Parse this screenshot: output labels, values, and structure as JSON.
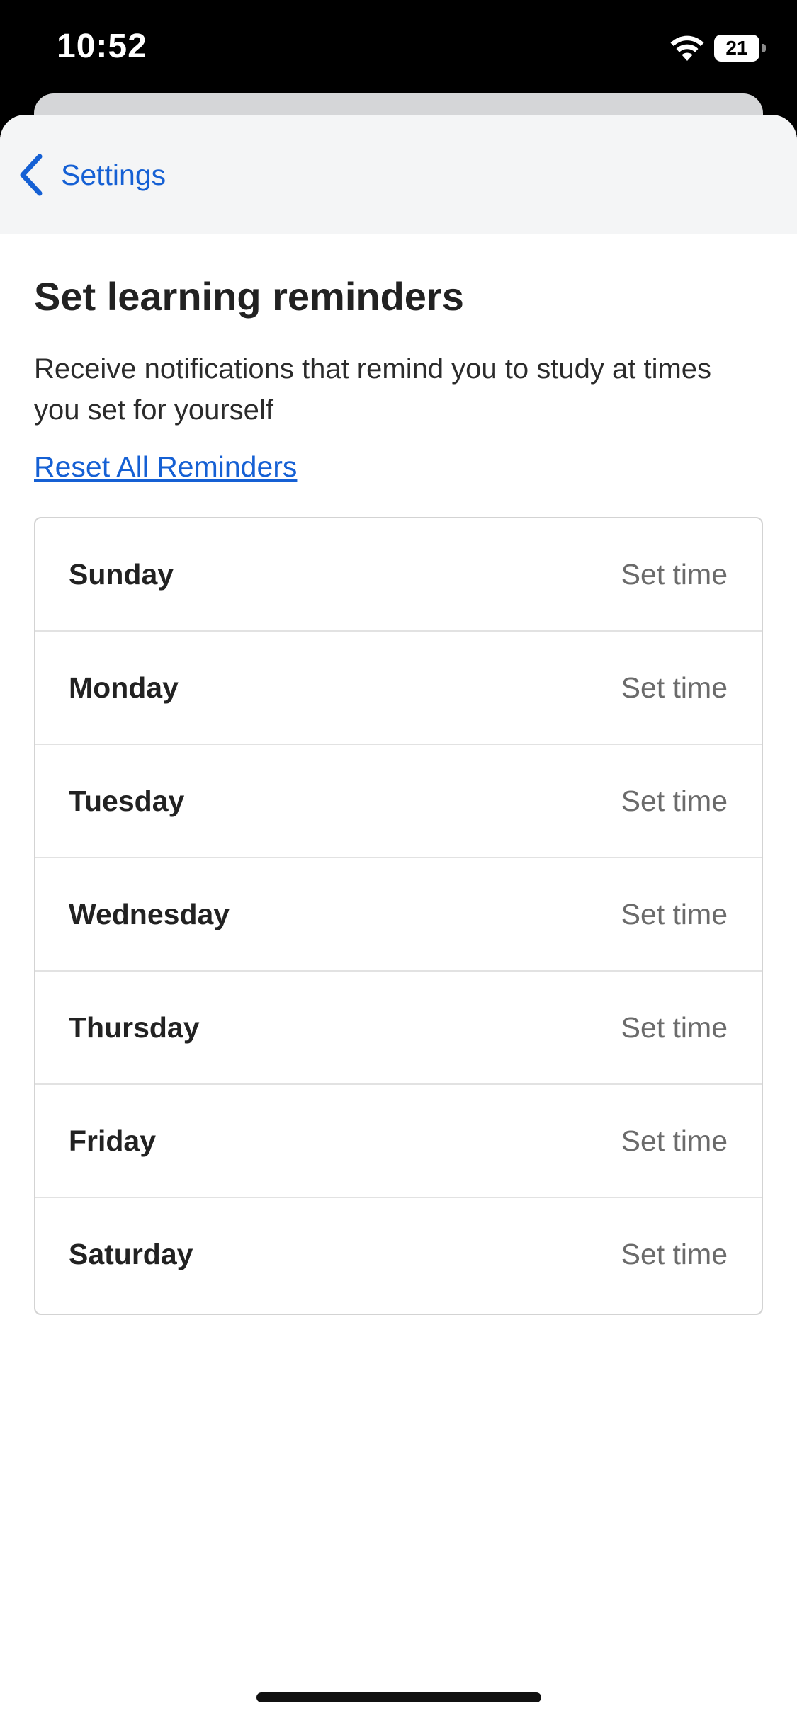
{
  "status_bar": {
    "time": "10:52",
    "battery_level": "21",
    "icons": [
      "wifi-icon",
      "battery-icon"
    ]
  },
  "nav": {
    "back_label": "Settings",
    "back_icon": "chevron-left-icon",
    "accent_color": "#1560d4"
  },
  "main": {
    "title": "Set learning reminders",
    "description": "Receive notifications that remind you to study at times you set for yourself",
    "reset_label": "Reset All Reminders"
  },
  "days": [
    {
      "name": "Sunday",
      "action": "Set time"
    },
    {
      "name": "Monday",
      "action": "Set time"
    },
    {
      "name": "Tuesday",
      "action": "Set time"
    },
    {
      "name": "Wednesday",
      "action": "Set time"
    },
    {
      "name": "Thursday",
      "action": "Set time"
    },
    {
      "name": "Friday",
      "action": "Set time"
    },
    {
      "name": "Saturday",
      "action": "Set time"
    }
  ]
}
